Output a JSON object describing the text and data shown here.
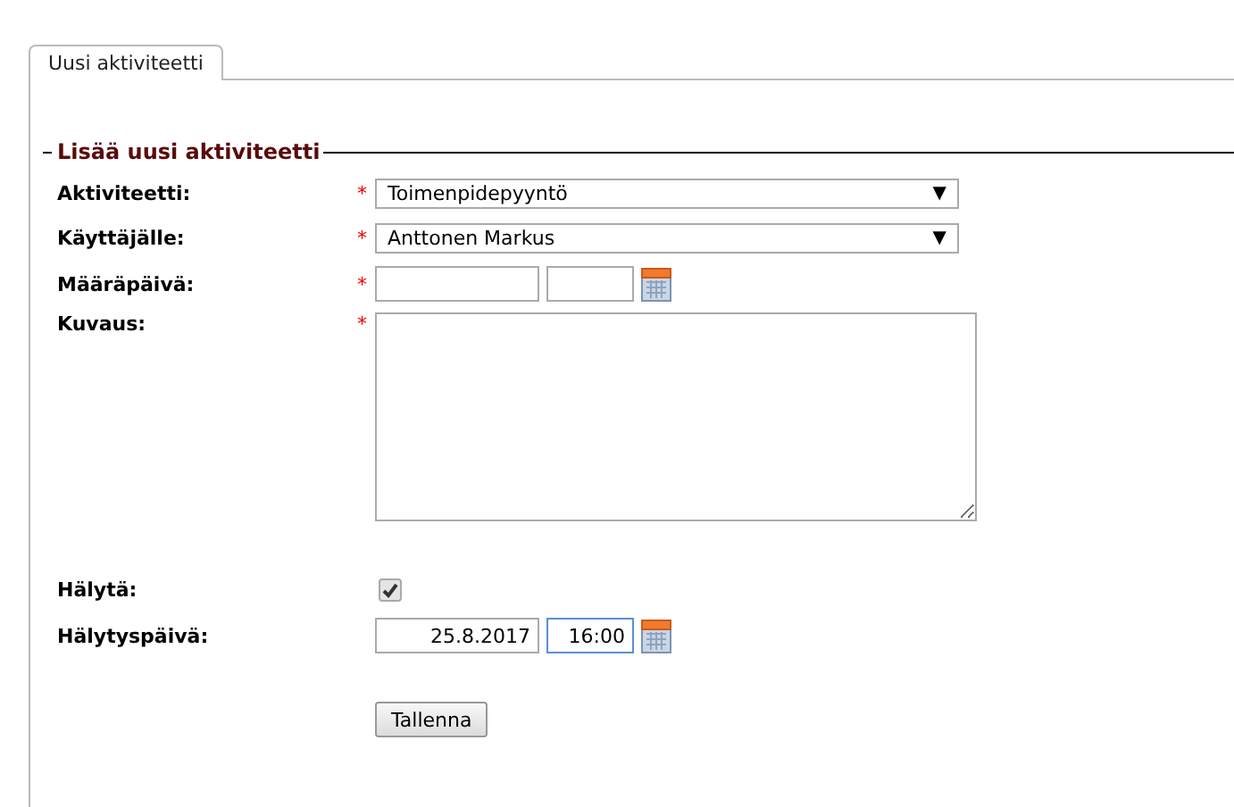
{
  "tabs": [
    {
      "label": "Uusi aktiviteetti",
      "selected": true
    }
  ],
  "legend": "Lisää uusi aktiviteetti",
  "fields": [
    {
      "kind": "select",
      "label": "Aktiviteetti:",
      "required": true,
      "value": "Toimenpidepyyntö"
    },
    {
      "kind": "select",
      "label": "Käyttäjälle:",
      "required": true,
      "value": "Anttonen Markus"
    },
    {
      "kind": "datetime",
      "label": "Määräpäivä:",
      "required": true,
      "focused": false
    },
    {
      "kind": "textarea",
      "label": "Kuvaus:",
      "required": true
    },
    {
      "kind": "checkbox",
      "label": "Hälytä:",
      "required": false,
      "checked": true
    },
    {
      "kind": "datetime",
      "label": "Hälytyspäivä:",
      "required": false,
      "date": "25.8.2017",
      "time": "16:00",
      "focused": true
    }
  ],
  "required_mark": "*",
  "select_caret": "▼",
  "save_button": "Tallenna"
}
